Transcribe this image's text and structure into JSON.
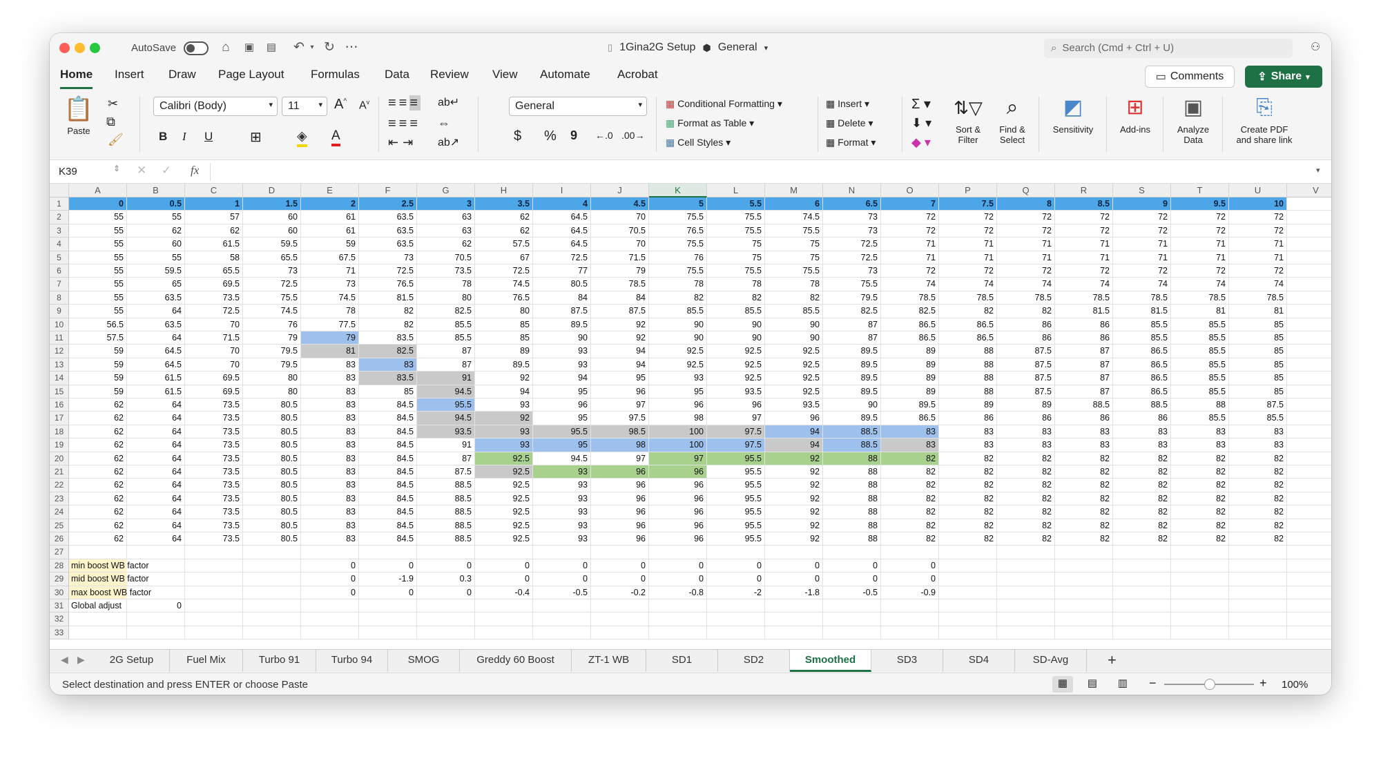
{
  "titlebar": {
    "autosave_label": "AutoSave",
    "doc_title": "1Gina2G Setup",
    "sensitivity": "General",
    "search_placeholder": "Search (Cmd + Ctrl + U)"
  },
  "tabs": [
    "Home",
    "Insert",
    "Draw",
    "Page Layout",
    "Formulas",
    "Data",
    "Review",
    "View",
    "Automate",
    "Acrobat"
  ],
  "header_buttons": {
    "comments": "Comments",
    "share": "Share"
  },
  "ribbon": {
    "paste": "Paste",
    "font_name": "Calibri (Body)",
    "font_size": "11",
    "number_format": "General",
    "conditional_formatting": "Conditional Formatting",
    "format_as_table": "Format as Table",
    "cell_styles": "Cell Styles",
    "insert": "Insert",
    "delete": "Delete",
    "format": "Format",
    "sort_filter": [
      "Sort &",
      "Filter"
    ],
    "find_select": [
      "Find &",
      "Select"
    ],
    "sensitivity": "Sensitivity",
    "addins": "Add-ins",
    "analyze": [
      "Analyze",
      "Data"
    ],
    "create_pdf": [
      "Create PDF",
      "and share link"
    ],
    "bold": "B",
    "italic": "I",
    "underline": "U",
    "font_color_glyph": "A",
    "currency": "$",
    "percent": "%",
    "comma": "9"
  },
  "formula_bar": {
    "name_box": "K39",
    "fx": "fx",
    "formula": ""
  },
  "grid": {
    "columns": [
      "A",
      "B",
      "C",
      "D",
      "E",
      "F",
      "G",
      "H",
      "I",
      "J",
      "K",
      "L",
      "M",
      "N",
      "O",
      "P",
      "Q",
      "R",
      "S",
      "T",
      "U",
      "V"
    ],
    "selected_column": "K",
    "row_numbers": [
      "1",
      "2",
      "3",
      "4",
      "5",
      "6",
      "7",
      "8",
      "9",
      "10",
      "11",
      "12",
      "13",
      "14",
      "15",
      "16",
      "17",
      "18",
      "19",
      "20",
      "21",
      "22",
      "23",
      "24",
      "25",
      "26",
      "27",
      "28",
      "29",
      "30",
      "31",
      "32",
      "33"
    ],
    "rows": [
      [
        "0",
        "0.5",
        "1",
        "1.5",
        "2",
        "2.5",
        "3",
        "3.5",
        "4",
        "4.5",
        "5",
        "5.5",
        "6",
        "6.5",
        "7",
        "7.5",
        "8",
        "8.5",
        "9",
        "9.5",
        "10"
      ],
      [
        "55",
        "55",
        "57",
        "60",
        "61",
        "63.5",
        "63",
        "62",
        "64.5",
        "70",
        "75.5",
        "75.5",
        "74.5",
        "73",
        "72",
        "72",
        "72",
        "72",
        "72",
        "72",
        "72"
      ],
      [
        "55",
        "62",
        "62",
        "60",
        "61",
        "63.5",
        "63",
        "62",
        "64.5",
        "70.5",
        "76.5",
        "75.5",
        "75.5",
        "73",
        "72",
        "72",
        "72",
        "72",
        "72",
        "72",
        "72"
      ],
      [
        "55",
        "60",
        "61.5",
        "59.5",
        "59",
        "63.5",
        "62",
        "57.5",
        "64.5",
        "70",
        "75.5",
        "75",
        "75",
        "72.5",
        "71",
        "71",
        "71",
        "71",
        "71",
        "71",
        "71"
      ],
      [
        "55",
        "55",
        "58",
        "65.5",
        "67.5",
        "73",
        "70.5",
        "67",
        "72.5",
        "71.5",
        "76",
        "75",
        "75",
        "72.5",
        "71",
        "71",
        "71",
        "71",
        "71",
        "71",
        "71"
      ],
      [
        "55",
        "59.5",
        "65.5",
        "73",
        "71",
        "72.5",
        "73.5",
        "72.5",
        "77",
        "79",
        "75.5",
        "75.5",
        "75.5",
        "73",
        "72",
        "72",
        "72",
        "72",
        "72",
        "72",
        "72"
      ],
      [
        "55",
        "65",
        "69.5",
        "72.5",
        "73",
        "76.5",
        "78",
        "74.5",
        "80.5",
        "78.5",
        "78",
        "78",
        "78",
        "75.5",
        "74",
        "74",
        "74",
        "74",
        "74",
        "74",
        "74"
      ],
      [
        "55",
        "63.5",
        "73.5",
        "75.5",
        "74.5",
        "81.5",
        "80",
        "76.5",
        "84",
        "84",
        "82",
        "82",
        "82",
        "79.5",
        "78.5",
        "78.5",
        "78.5",
        "78.5",
        "78.5",
        "78.5",
        "78.5"
      ],
      [
        "55",
        "64",
        "72.5",
        "74.5",
        "78",
        "82",
        "82.5",
        "80",
        "87.5",
        "87.5",
        "85.5",
        "85.5",
        "85.5",
        "82.5",
        "82.5",
        "82",
        "82",
        "81.5",
        "81.5",
        "81",
        "81"
      ],
      [
        "56.5",
        "63.5",
        "70",
        "76",
        "77.5",
        "82",
        "85.5",
        "85",
        "89.5",
        "92",
        "90",
        "90",
        "90",
        "87",
        "86.5",
        "86.5",
        "86",
        "86",
        "85.5",
        "85.5",
        "85"
      ],
      [
        "57.5",
        "64",
        "71.5",
        "79",
        "79",
        "83.5",
        "85.5",
        "85",
        "90",
        "92",
        "90",
        "90",
        "90",
        "87",
        "86.5",
        "86.5",
        "86",
        "86",
        "85.5",
        "85.5",
        "85"
      ],
      [
        "59",
        "64.5",
        "70",
        "79.5",
        "81",
        "82.5",
        "87",
        "89",
        "93",
        "94",
        "92.5",
        "92.5",
        "92.5",
        "89.5",
        "89",
        "88",
        "87.5",
        "87",
        "86.5",
        "85.5",
        "85"
      ],
      [
        "59",
        "64.5",
        "70",
        "79.5",
        "83",
        "83",
        "87",
        "89.5",
        "93",
        "94",
        "92.5",
        "92.5",
        "92.5",
        "89.5",
        "89",
        "88",
        "87.5",
        "87",
        "86.5",
        "85.5",
        "85"
      ],
      [
        "59",
        "61.5",
        "69.5",
        "80",
        "83",
        "83.5",
        "91",
        "92",
        "94",
        "95",
        "93",
        "92.5",
        "92.5",
        "89.5",
        "89",
        "88",
        "87.5",
        "87",
        "86.5",
        "85.5",
        "85"
      ],
      [
        "59",
        "61.5",
        "69.5",
        "80",
        "83",
        "85",
        "94.5",
        "94",
        "95",
        "96",
        "95",
        "93.5",
        "92.5",
        "89.5",
        "89",
        "88",
        "87.5",
        "87",
        "86.5",
        "85.5",
        "85"
      ],
      [
        "62",
        "64",
        "73.5",
        "80.5",
        "83",
        "84.5",
        "95.5",
        "93",
        "96",
        "97",
        "96",
        "96",
        "93.5",
        "90",
        "89.5",
        "89",
        "89",
        "88.5",
        "88.5",
        "88",
        "87.5"
      ],
      [
        "62",
        "64",
        "73.5",
        "80.5",
        "83",
        "84.5",
        "94.5",
        "92",
        "95",
        "97.5",
        "98",
        "97",
        "96",
        "89.5",
        "86.5",
        "86",
        "86",
        "86",
        "86",
        "85.5",
        "85.5"
      ],
      [
        "62",
        "64",
        "73.5",
        "80.5",
        "83",
        "84.5",
        "93.5",
        "93",
        "95.5",
        "98.5",
        "100",
        "97.5",
        "94",
        "88.5",
        "83",
        "83",
        "83",
        "83",
        "83",
        "83",
        "83"
      ],
      [
        "62",
        "64",
        "73.5",
        "80.5",
        "83",
        "84.5",
        "91",
        "93",
        "95",
        "98",
        "100",
        "97.5",
        "94",
        "88.5",
        "83",
        "83",
        "83",
        "83",
        "83",
        "83",
        "83"
      ],
      [
        "62",
        "64",
        "73.5",
        "80.5",
        "83",
        "84.5",
        "87",
        "92.5",
        "94.5",
        "97",
        "97",
        "95.5",
        "92",
        "88",
        "82",
        "82",
        "82",
        "82",
        "82",
        "82",
        "82"
      ],
      [
        "62",
        "64",
        "73.5",
        "80.5",
        "83",
        "84.5",
        "87.5",
        "92.5",
        "93",
        "96",
        "96",
        "95.5",
        "92",
        "88",
        "82",
        "82",
        "82",
        "82",
        "82",
        "82",
        "82"
      ],
      [
        "62",
        "64",
        "73.5",
        "80.5",
        "83",
        "84.5",
        "88.5",
        "92.5",
        "93",
        "96",
        "96",
        "95.5",
        "92",
        "88",
        "82",
        "82",
        "82",
        "82",
        "82",
        "82",
        "82"
      ],
      [
        "62",
        "64",
        "73.5",
        "80.5",
        "83",
        "84.5",
        "88.5",
        "92.5",
        "93",
        "96",
        "96",
        "95.5",
        "92",
        "88",
        "82",
        "82",
        "82",
        "82",
        "82",
        "82",
        "82"
      ],
      [
        "62",
        "64",
        "73.5",
        "80.5",
        "83",
        "84.5",
        "88.5",
        "92.5",
        "93",
        "96",
        "96",
        "95.5",
        "92",
        "88",
        "82",
        "82",
        "82",
        "82",
        "82",
        "82",
        "82"
      ],
      [
        "62",
        "64",
        "73.5",
        "80.5",
        "83",
        "84.5",
        "88.5",
        "92.5",
        "93",
        "96",
        "96",
        "95.5",
        "92",
        "88",
        "82",
        "82",
        "82",
        "82",
        "82",
        "82",
        "82"
      ],
      [
        "62",
        "64",
        "73.5",
        "80.5",
        "83",
        "84.5",
        "88.5",
        "92.5",
        "93",
        "96",
        "96",
        "95.5",
        "92",
        "88",
        "82",
        "82",
        "82",
        "82",
        "82",
        "82",
        "82"
      ]
    ],
    "factors": {
      "min_label": "min boost WB factor",
      "min": [
        "0",
        "0",
        "0",
        "0",
        "0",
        "0",
        "0",
        "0",
        "0",
        "0",
        "0"
      ],
      "mid_label": "mid boost WB factor",
      "mid": [
        "0",
        "-1.9",
        "0.3",
        "0",
        "0",
        "0",
        "0",
        "0",
        "0",
        "0",
        "0"
      ],
      "max_label": "max boost WB factor",
      "max": [
        "0",
        "0",
        "0",
        "-0.4",
        "-0.5",
        "-0.2",
        "-0.8",
        "-2",
        "-1.8",
        "-0.5",
        "-0.9"
      ],
      "global_label": "Global adjust",
      "global_value": "0"
    },
    "colors": {
      "header_row": "#4da6e8",
      "gray": "#c9c9c9",
      "blue": "#9dc0ec",
      "green": "#a9d18e",
      "label_fill": "#fdf4cc"
    }
  },
  "sheet_tabs": [
    "2G Setup",
    "Fuel Mix",
    "Turbo 91",
    "Turbo 94",
    "SMOG",
    "Greddy 60 Boost",
    "ZT-1 WB",
    "SD1",
    "SD2",
    "Smoothed",
    "SD3",
    "SD4",
    "SD-Avg"
  ],
  "active_sheet": "Smoothed",
  "status": {
    "message": "Select destination and press ENTER or choose Paste",
    "zoom": "100%"
  }
}
